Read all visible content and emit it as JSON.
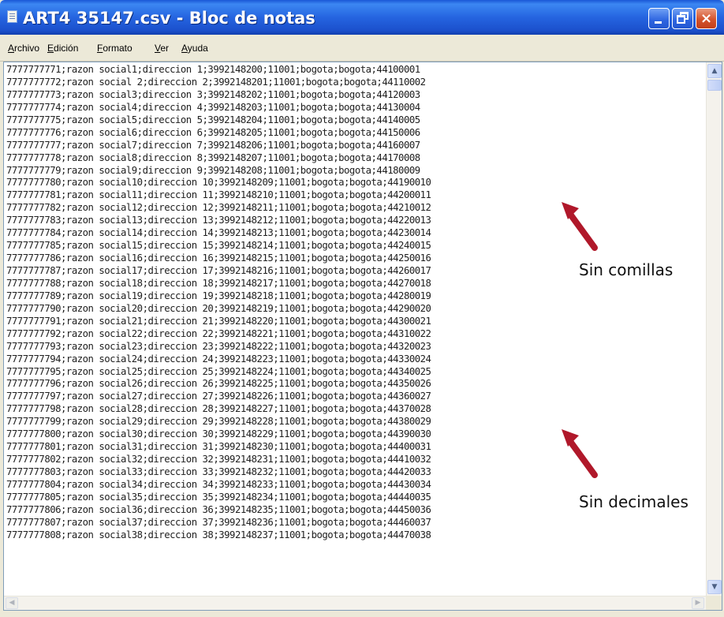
{
  "window": {
    "title": "ART4 35147.csv - Bloc de notas",
    "controls": {
      "minimize": "minimize",
      "maximize": "maximize",
      "close": "×"
    }
  },
  "menu": [
    "Archivo",
    "Edición",
    "Formato",
    "Ver",
    "Ayuda"
  ],
  "editor": {
    "lines": [
      "7777777771;razon social1;direccion 1;3992148200;11001;bogota;bogota;44100001",
      "7777777772;razon social 2;direccion 2;3992148201;11001;bogota;bogota;44110002",
      "7777777773;razon social3;direccion 3;3992148202;11001;bogota;bogota;44120003",
      "7777777774;razon social4;direccion 4;3992148203;11001;bogota;bogota;44130004",
      "7777777775;razon social5;direccion 5;3992148204;11001;bogota;bogota;44140005",
      "7777777776;razon social6;direccion 6;3992148205;11001;bogota;bogota;44150006",
      "7777777777;razon social7;direccion 7;3992148206;11001;bogota;bogota;44160007",
      "7777777778;razon social8;direccion 8;3992148207;11001;bogota;bogota;44170008",
      "7777777779;razon social9;direccion 9;3992148208;11001;bogota;bogota;44180009",
      "7777777780;razon social10;direccion 10;3992148209;11001;bogota;bogota;44190010",
      "7777777781;razon social11;direccion 11;3992148210;11001;bogota;bogota;44200011",
      "7777777782;razon social12;direccion 12;3992148211;11001;bogota;bogota;44210012",
      "7777777783;razon social13;direccion 13;3992148212;11001;bogota;bogota;44220013",
      "7777777784;razon social14;direccion 14;3992148213;11001;bogota;bogota;44230014",
      "7777777785;razon social15;direccion 15;3992148214;11001;bogota;bogota;44240015",
      "7777777786;razon social16;direccion 16;3992148215;11001;bogota;bogota;44250016",
      "7777777787;razon social17;direccion 17;3992148216;11001;bogota;bogota;44260017",
      "7777777788;razon social18;direccion 18;3992148217;11001;bogota;bogota;44270018",
      "7777777789;razon social19;direccion 19;3992148218;11001;bogota;bogota;44280019",
      "7777777790;razon social20;direccion 20;3992148219;11001;bogota;bogota;44290020",
      "7777777791;razon social21;direccion 21;3992148220;11001;bogota;bogota;44300021",
      "7777777792;razon social22;direccion 22;3992148221;11001;bogota;bogota;44310022",
      "7777777793;razon social23;direccion 23;3992148222;11001;bogota;bogota;44320023",
      "7777777794;razon social24;direccion 24;3992148223;11001;bogota;bogota;44330024",
      "7777777795;razon social25;direccion 25;3992148224;11001;bogota;bogota;44340025",
      "7777777796;razon social26;direccion 26;3992148225;11001;bogota;bogota;44350026",
      "7777777797;razon social27;direccion 27;3992148226;11001;bogota;bogota;44360027",
      "7777777798;razon social28;direccion 28;3992148227;11001;bogota;bogota;44370028",
      "7777777799;razon social29;direccion 29;3992148228;11001;bogota;bogota;44380029",
      "7777777800;razon social30;direccion 30;3992148229;11001;bogota;bogota;44390030",
      "7777777801;razon social31;direccion 31;3992148230;11001;bogota;bogota;44400031",
      "7777777802;razon social32;direccion 32;3992148231;11001;bogota;bogota;44410032",
      "7777777803;razon social33;direccion 33;3992148232;11001;bogota;bogota;44420033",
      "7777777804;razon social34;direccion 34;3992148233;11001;bogota;bogota;44430034",
      "7777777805;razon social35;direccion 35;3992148234;11001;bogota;bogota;44440035",
      "7777777806;razon social36;direccion 36;3992148235;11001;bogota;bogota;44450036",
      "7777777807;razon social37;direccion 37;3992148236;11001;bogota;bogota;44460037",
      "7777777808;razon social38;direccion 38;3992148237;11001;bogota;bogota;44470038"
    ]
  },
  "annotations": [
    {
      "text": "Sin comillas"
    },
    {
      "text": "Sin decimales"
    }
  ],
  "colors": {
    "title_bar": "#245edb",
    "arrow": "#b0182a",
    "window_frame": "#ece9d8"
  }
}
